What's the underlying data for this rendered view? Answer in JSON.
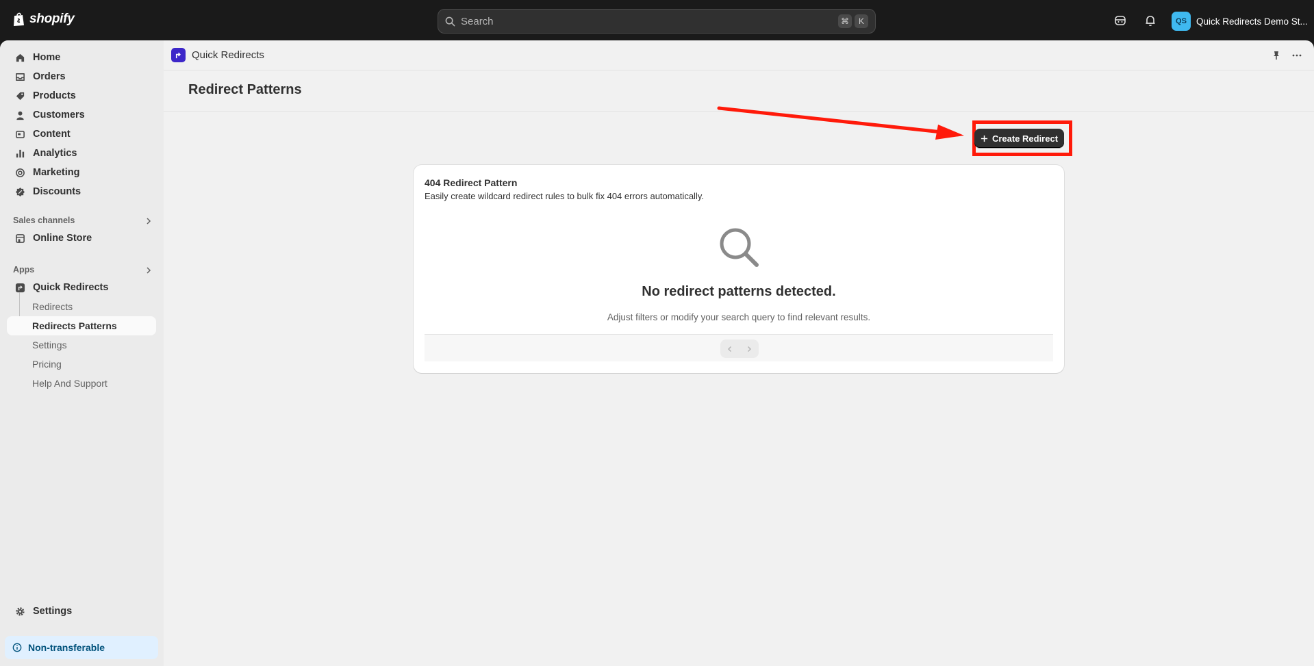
{
  "topbar": {
    "logo_text": "shopify",
    "search_placeholder": "Search",
    "shortcut_keys": [
      "⌘",
      "K"
    ],
    "store_initials": "QS",
    "store_name": "Quick Redirects Demo St..."
  },
  "sidebar": {
    "main_items": [
      {
        "label": "Home",
        "icon": "home-icon"
      },
      {
        "label": "Orders",
        "icon": "orders-icon"
      },
      {
        "label": "Products",
        "icon": "tag-icon"
      },
      {
        "label": "Customers",
        "icon": "person-icon"
      },
      {
        "label": "Content",
        "icon": "content-icon"
      },
      {
        "label": "Analytics",
        "icon": "chart-icon"
      },
      {
        "label": "Marketing",
        "icon": "target-icon"
      },
      {
        "label": "Discounts",
        "icon": "discount-icon"
      }
    ],
    "sales_channels_label": "Sales channels",
    "online_store_label": "Online Store",
    "apps_label": "Apps",
    "app_label": "Quick Redirects",
    "app_subitems": [
      "Redirects",
      "Redirects Patterns",
      "Settings",
      "Pricing",
      "Help And Support"
    ],
    "settings_label": "Settings",
    "nontransferable_label": "Non-transferable"
  },
  "app_header": {
    "app_name": "Quick Redirects"
  },
  "page": {
    "title": "Redirect Patterns",
    "create_button_label": "Create Redirect"
  },
  "card": {
    "title": "404 Redirect Pattern",
    "subtitle": "Easily create wildcard redirect rules to bulk fix 404 errors automatically.",
    "empty_title": "No redirect patterns detected.",
    "empty_subtitle": "Adjust filters or modify your search query to find relevant results."
  },
  "colors": {
    "accent_annotation": "#ff1a0a",
    "app_logo": "#3d27c9",
    "avatar": "#3fb9f0"
  }
}
